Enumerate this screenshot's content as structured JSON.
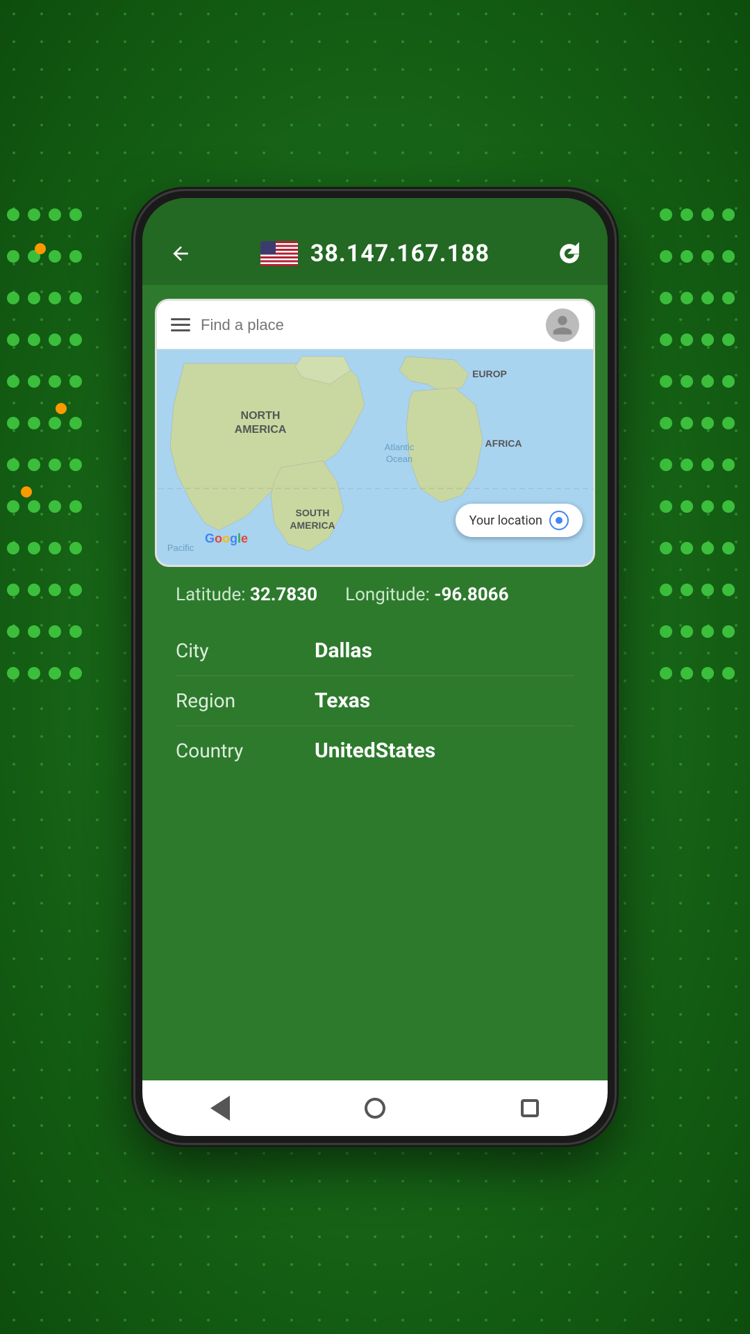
{
  "background": {
    "color": "#1a7a1a"
  },
  "header": {
    "back_label": "←",
    "ip_address": "38.147.167.188",
    "refresh_label": "↻",
    "flag_country": "US"
  },
  "map": {
    "search_placeholder": "Find a place",
    "your_location_label": "Your location",
    "labels": {
      "north_america": "NORTH\nAMERICA",
      "europe": "EUROP",
      "africa": "AFRICA",
      "south_america": "SOUTH\nAMERICA",
      "atlantic_ocean": "Atlantic\nOcean",
      "pacific": "Pacific",
      "google": "Google"
    }
  },
  "location": {
    "latitude_label": "Latitude:",
    "latitude_value": "32.7830",
    "longitude_label": "Longitude:",
    "longitude_value": "-96.8066",
    "city_label": "City",
    "city_value": "Dallas",
    "region_label": "Region",
    "region_value": "Texas",
    "country_label": "Country",
    "country_value": "UnitedStates"
  },
  "nav": {
    "back_label": "back",
    "home_label": "home",
    "recents_label": "recents"
  }
}
